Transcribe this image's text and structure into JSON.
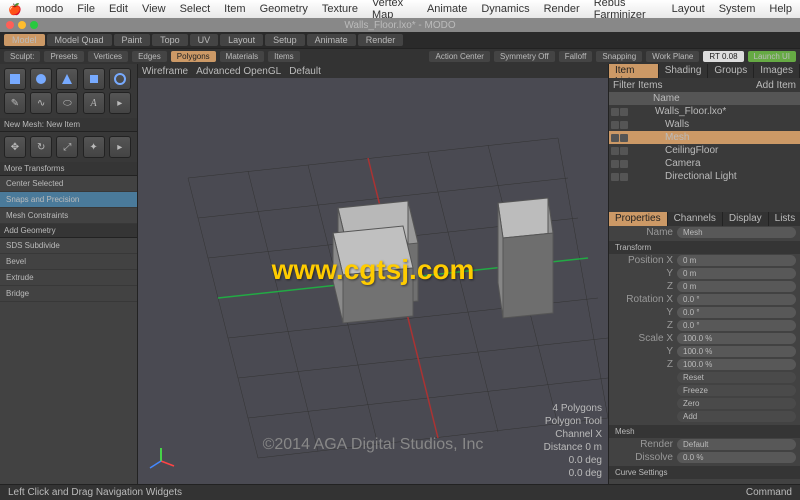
{
  "menubar": {
    "items": [
      "modo",
      "File",
      "Edit",
      "View",
      "Select",
      "Item",
      "Geometry",
      "Texture",
      "Vertex Map",
      "Animate",
      "Dynamics",
      "Render",
      "Rebus Farminizer",
      "Layout",
      "System",
      "Help"
    ]
  },
  "window_title": "Walls_Floor.lxo* - MODO",
  "tabs": {
    "items": [
      "Model",
      "Model Quad",
      "Paint",
      "Topo",
      "UV",
      "Layout",
      "Setup",
      "Animate",
      "Render"
    ],
    "active": 0
  },
  "toolbar": {
    "sculpt": "Sculpt:",
    "presets": "Presets",
    "vertices": "Vertices",
    "edges": "Edges",
    "polygons": "Polygons",
    "materials": "Materials",
    "items": "Items",
    "action_center": "Action Center",
    "symmetry": "Symmetry Off",
    "falloff": "Falloff",
    "snapping": "Snapping",
    "workplane": "Work Plane",
    "renderer": "RT 0.08",
    "launch": "Launch UI"
  },
  "left_panel": {
    "new_mesh": "New Mesh: New Item",
    "more_transforms": "More Transforms",
    "center_selected": "Center Selected",
    "snaps": "Snaps and Precision",
    "constraints": "Mesh Constraints",
    "add_geometry": "Add Geometry",
    "items": [
      "SDS Subdivide",
      "Bevel",
      "Extrude",
      "Bridge"
    ]
  },
  "viewport": {
    "header_items": [
      "Wireframe",
      "Advanced OpenGL",
      "Default"
    ]
  },
  "watermark": "www.cgtsj.com",
  "copyright": "©2014 AGA Digital Studios, Inc",
  "stats": {
    "l1": "4 Polygons",
    "l2": "Polygon Tool",
    "l3": "Channel X",
    "l4": "Distance 0 m",
    "l5": "0.0 deg",
    "l6": "0.0 deg"
  },
  "item_list": {
    "tabs": [
      "Item List",
      "Shading",
      "Groups",
      "Images"
    ],
    "filter": "Filter Items",
    "add": "Add Item",
    "hdr_name": "Name",
    "rows": [
      {
        "name": "Walls_Floor.lxo*",
        "indent": 0,
        "sel": false
      },
      {
        "name": "Walls",
        "indent": 1,
        "sel": false
      },
      {
        "name": "Mesh",
        "indent": 1,
        "sel": true
      },
      {
        "name": "CeilingFloor",
        "indent": 1,
        "sel": false
      },
      {
        "name": "Camera",
        "indent": 1,
        "sel": false
      },
      {
        "name": "Directional Light",
        "indent": 1,
        "sel": false
      }
    ]
  },
  "properties": {
    "tabs": [
      "Properties",
      "Channels",
      "Display",
      "Lists"
    ],
    "name_label": "Name",
    "name_value": "Mesh",
    "transform": "Transform",
    "position": "Position X",
    "pos_x": "0 m",
    "pos_y": "0 m",
    "pos_z": "0 m",
    "rotation": "Rotation X",
    "rot_x": "0.0 °",
    "rot_y": "0.0 °",
    "rot_z": "0.0 °",
    "scale": "Scale X",
    "scl_x": "100.0 %",
    "scl_y": "100.0 %",
    "scl_z": "100.0 %",
    "btns": [
      "Reset",
      "Freeze",
      "Zero",
      "Add"
    ],
    "mesh": "Mesh",
    "render_label": "Render",
    "render_val": "Default",
    "dissolve_label": "Dissolve",
    "dissolve_val": "0.0 %",
    "curve": "Curve Settings"
  },
  "statusbar": {
    "left": "Left Click and Drag    Navigation Widgets",
    "right": "Command"
  }
}
